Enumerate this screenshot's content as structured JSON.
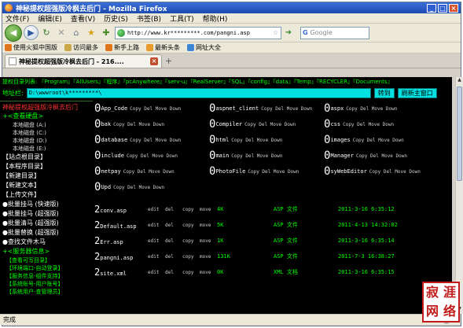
{
  "window": {
    "title": "神秘提权超强版冷枫去后门 - Mozilla Firefox"
  },
  "menu": [
    "文件(F)",
    "编辑(E)",
    "查看(V)",
    "历史(S)",
    "书签(B)",
    "工具(T)",
    "帮助(H)"
  ],
  "nav": {
    "url": "http://www.kr*********.com/pangni.asp",
    "search_placeholder": "Google"
  },
  "bookmarks": [
    {
      "label": "使用火狐中国版"
    },
    {
      "label": "访问最多"
    },
    {
      "label": "新手上路"
    },
    {
      "label": "最新头条"
    },
    {
      "label": "网址大全"
    }
  ],
  "tab": {
    "label": "神秘提权超强版冷枫去后门 - 216...."
  },
  "page": {
    "paths_line": "提权目录列表: 『Program』『AllUsers』『程序』『pcAnywhere』『serv-u』『RealServer』『SQL』『config』『data』『Temp』『RECYCLER』『Documents』",
    "address_label": "地址栏:",
    "address_value": "D:\\wwwroot\\k*********\\",
    "goto_button": "转到",
    "refresh_button": "刷新主窗口"
  },
  "sidebar": {
    "red_title": "神秘提权超强版冷枫去后门",
    "disk_section": "+<查看硬盘>",
    "drives": [
      "本地磁盘 (A:)",
      "本地磁盘 (C:)",
      "本地磁盘 (D:)",
      "本地磁盘 (E:)"
    ],
    "items": [
      "【站点根目录】",
      "【本程序目录】",
      "【新建目录】",
      "【新建文本】",
      "【上传文件】"
    ],
    "bullets": [
      "●批量挂马 (快速版)",
      "●批量挂马 (超强版)",
      "●批量清马 (超强版)",
      "●批量替换 (超强版)",
      "●查找文件木马"
    ],
    "service_section": "+<服务器信息>",
    "service_items": [
      "【查看可写目录】",
      "【环境端口-自动登录】",
      "【服务信息-组件支持】",
      "【系统账号-用户账号】",
      "【系统用户-查管理员】"
    ]
  },
  "dirs": [
    {
      "initial": "0",
      "name": "App_Code",
      "ops": "Copy Del Move Down"
    },
    {
      "initial": "0",
      "name": "aspnet_client",
      "ops": "Copy Del Move Down"
    },
    {
      "initial": "0",
      "name": "aspx",
      "ops": "Copy Del Move Down"
    },
    {
      "initial": "0",
      "name": "bak",
      "ops": "Copy Del Move Down"
    },
    {
      "initial": "0",
      "name": "Compiler",
      "ops": "Copy Del Move Down"
    },
    {
      "initial": "0",
      "name": "css",
      "ops": "Copy Del Move Down"
    },
    {
      "initial": "0",
      "name": "database",
      "ops": "Copy Del Move Down"
    },
    {
      "initial": "0",
      "name": "html",
      "ops": "Copy Del Move Down"
    },
    {
      "initial": "0",
      "name": "images",
      "ops": "Copy Del Move Down"
    },
    {
      "initial": "0",
      "name": "include",
      "ops": "Copy Del Move Down"
    },
    {
      "initial": "0",
      "name": "main",
      "ops": "Copy Del Move Down"
    },
    {
      "initial": "0",
      "name": "Manager",
      "ops": "Copy Del Move Down"
    },
    {
      "initial": "0",
      "name": "netpay",
      "ops": "Copy Del Move Down"
    },
    {
      "initial": "0",
      "name": "PhotoFile",
      "ops": "Copy Del Move Down"
    },
    {
      "initial": "0",
      "name": "syWebEditor",
      "ops": "Copy Del Move Down"
    },
    {
      "initial": "0",
      "name": "Upd",
      "ops": "Copy Del Move Down"
    }
  ],
  "files": [
    {
      "initial": "2",
      "name": "conv.asp",
      "edit": "edit",
      "del": "del",
      "copy": "copy",
      "move": "move",
      "size": "4K",
      "type": "ASP 文件",
      "date": "2011-3-16 6:35:12"
    },
    {
      "initial": "2",
      "name": "Default.asp",
      "edit": "edit",
      "del": "del",
      "copy": "copy",
      "move": "move",
      "size": "5K",
      "type": "ASP 文件",
      "date": "2011-4-13 14:32:02"
    },
    {
      "initial": "2",
      "name": "Err.asp",
      "edit": "edit",
      "del": "del",
      "copy": "copy",
      "move": "move",
      "size": "1K",
      "type": "ASP 文件",
      "date": "2011-3-16 6:35:14"
    },
    {
      "initial": "2",
      "name": "pangni.asp",
      "edit": "edit",
      "del": "del",
      "copy": "copy",
      "move": "move",
      "size": "131K",
      "type": "ASP 文件",
      "date": "2011-7-3 16:38:27"
    },
    {
      "initial": "2",
      "name": "site.xml",
      "edit": "edit",
      "del": "del",
      "copy": "copy",
      "move": "move",
      "size": "0K",
      "type": "XML 文档",
      "date": "2011-3-16 6:35:15"
    }
  ],
  "status": {
    "text": "完成"
  },
  "watermark": [
    "寂",
    "涯",
    "网",
    "络"
  ]
}
